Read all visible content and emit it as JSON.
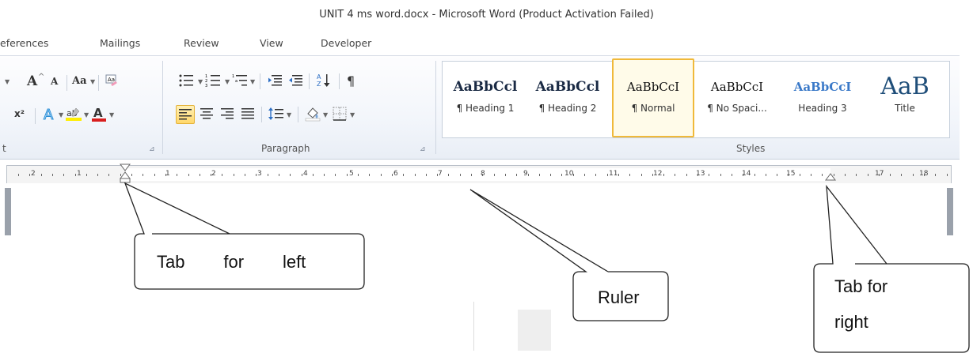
{
  "window": {
    "title": "UNIT 4 ms word.docx  -  Microsoft Word (Product Activation Failed)"
  },
  "tabs": [
    "eferences",
    "Mailings",
    "Review",
    "View",
    "Developer"
  ],
  "ribbon": {
    "groups": [
      "t",
      "Paragraph",
      "Styles"
    ],
    "font_buttons": {
      "grow": "A",
      "shrink": "A",
      "change_case": "Aa",
      "font_color": "A"
    },
    "pilcrow": "¶",
    "sort": "A↓Z"
  },
  "styles": [
    {
      "sample": "AaBbCcl",
      "name": "¶ Heading 1"
    },
    {
      "sample": "AaBbCcl",
      "name": "¶ Heading 2"
    },
    {
      "sample": "AaBbCcI",
      "name": "¶ Normal"
    },
    {
      "sample": "AaBbCcI",
      "name": "¶ No Spaci..."
    },
    {
      "sample": "AaBbCcI",
      "name": "Heading 3"
    },
    {
      "sample": "AaB",
      "name": "Title"
    }
  ],
  "ruler": {
    "numbers": [
      "2",
      "1",
      "1",
      "1",
      "2",
      "3",
      "4",
      "5",
      "6",
      "7",
      "8",
      "9",
      "10",
      "11",
      "12",
      "13",
      "14",
      "15",
      "17",
      "18"
    ]
  },
  "callouts": {
    "left": "Tab        for        left",
    "ruler": "Ruler",
    "right_line1": "Tab for",
    "right_line2": "right"
  },
  "colors": {
    "highlight": "#ffd76a",
    "heading_blue": "#1f4e9b",
    "font_red": "#d81e1e"
  }
}
